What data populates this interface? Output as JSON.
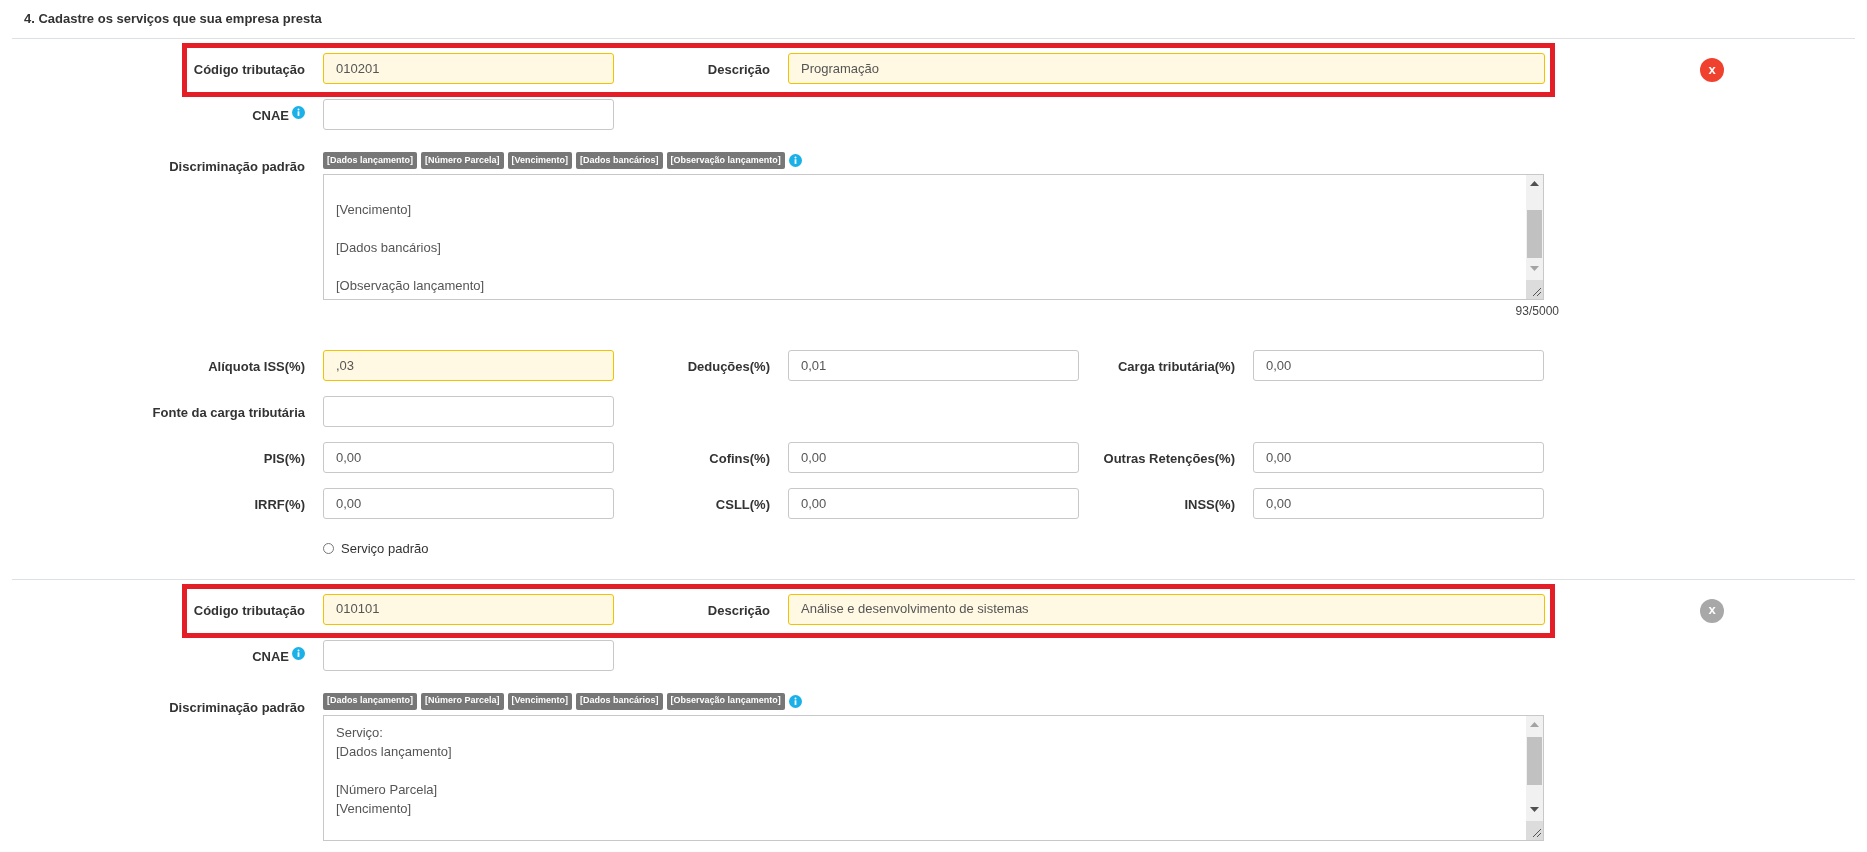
{
  "section_title": "4. Cadastre os serviços que sua empresa presta",
  "services": [
    {
      "highlight_box": true,
      "remove_button": {
        "label": "x",
        "active": true
      },
      "codigo": {
        "label": "Código tributação",
        "value": "010201",
        "highlighted": true
      },
      "descricao": {
        "label": "Descrição",
        "value": "Programação",
        "highlighted": true
      },
      "cnae": {
        "label": "CNAE"
      },
      "discriminacao": {
        "label": "Discriminação padrão",
        "tags": [
          "[Dados lançamento]",
          "[Número Parcela]",
          "[Vencimento]",
          "[Dados bancários]",
          "[Observação lançamento]"
        ],
        "scrolled": true,
        "value": "[Vencimento]\n\n[Dados bancários]\n\n[Observação lançamento]",
        "counter": "93/5000"
      },
      "tax_rows": [
        [
          {
            "label": "Alíquota ISS(%)",
            "value": ",03",
            "highlighted": true
          },
          {
            "label": "Deduções(%)",
            "value": "0,01",
            "highlighted": false
          },
          {
            "label": "Carga tributária(%)",
            "value": "0,00",
            "highlighted": false
          }
        ],
        [
          {
            "label": "Fonte da carga tributária",
            "highlighted": false
          }
        ],
        [
          {
            "label": "PIS(%)",
            "value": "0,00",
            "highlighted": false
          },
          {
            "label": "Cofins(%)",
            "value": "0,00",
            "highlighted": false
          },
          {
            "label": "Outras Retenções(%)",
            "value": "0,00",
            "highlighted": false
          }
        ],
        [
          {
            "label": "IRRF(%)",
            "value": "0,00",
            "highlighted": false
          },
          {
            "label": "CSLL(%)",
            "value": "0,00",
            "highlighted": false
          },
          {
            "label": "INSS(%)",
            "value": "0,00",
            "highlighted": false
          }
        ]
      ],
      "default_service": {
        "label": "Serviço padrão",
        "selected": false
      }
    },
    {
      "highlight_box": true,
      "remove_button": {
        "label": "x",
        "active": false
      },
      "codigo": {
        "label": "Código tributação",
        "value": "010101",
        "highlighted": true
      },
      "descricao": {
        "label": "Descrição",
        "value": "Análise e desenvolvimento de sistemas",
        "highlighted": true
      },
      "cnae": {
        "label": "CNAE"
      },
      "discriminacao": {
        "label": "Discriminação padrão",
        "tags": [
          "[Dados lançamento]",
          "[Número Parcela]",
          "[Vencimento]",
          "[Dados bancários]",
          "[Observação lançamento]"
        ],
        "scrolled": false,
        "value": "Serviço:\n[Dados lançamento]\n\n[Número Parcela]\n[Vencimento]"
      }
    }
  ]
}
